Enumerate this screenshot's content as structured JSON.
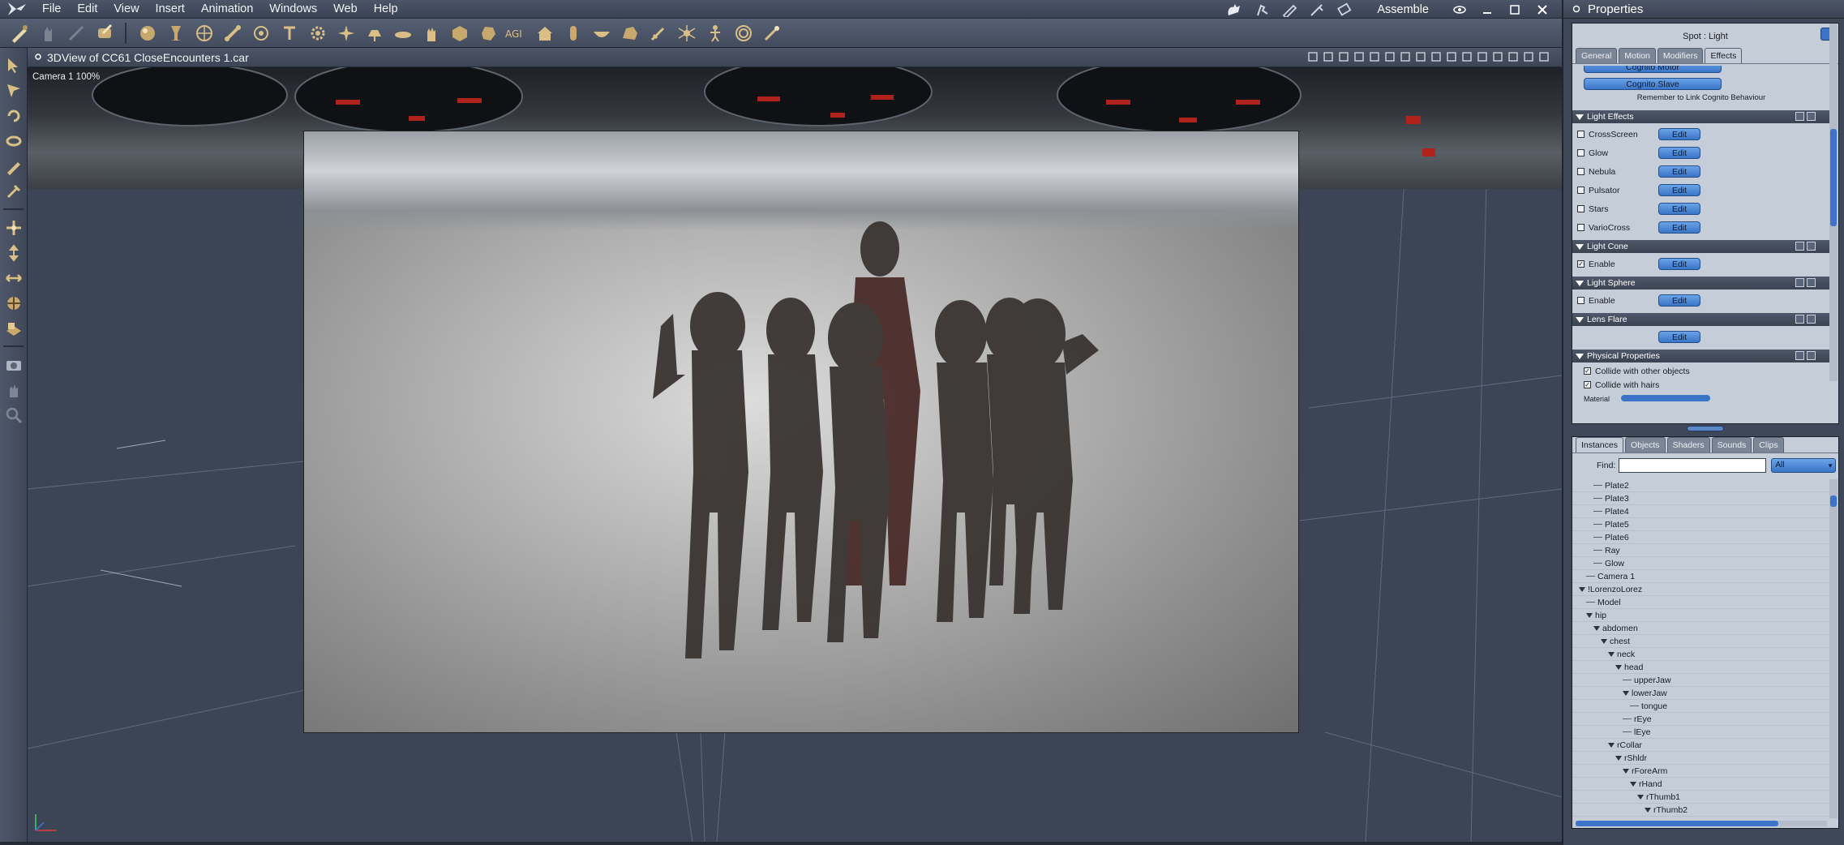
{
  "app": {
    "logo_icon": "poser-figure-logo-icon",
    "workspace": "Assemble"
  },
  "menu": {
    "items": [
      "File",
      "Edit",
      "View",
      "Insert",
      "Animation",
      "Windows",
      "Web",
      "Help"
    ]
  },
  "toolbar": {
    "icons": [
      "select-pen-icon",
      "figure-hand-icon",
      "disabled-tool-icon",
      "brush-tool-icon",
      "sphere-primitive-icon",
      "goblet-icon",
      "globe-icon",
      "bone-icon",
      "target-icon",
      "text-tool-icon",
      "gear-icon",
      "star-burst-icon",
      "lamp-icon",
      "plate-icon",
      "hand-icon",
      "cube-icon",
      "asteroid-icon",
      "text-agi-icon",
      "house-icon",
      "cylinder-icon",
      "dish-icon",
      "rock-icon",
      "sword-icon",
      "spider-icon",
      "puppet-icon",
      "target-ring-icon",
      "wand-icon"
    ]
  },
  "left_tools": {
    "icons": [
      "pointer-arrow-icon",
      "select-arrow-icon",
      "rotate-icon",
      "twist-icon",
      "pencil-icon",
      "pipette-icon",
      "move-xyz-icon",
      "translate-icon",
      "scale-icon",
      "orbit-icon",
      "floor-grid-icon",
      "camera-icon",
      "hand-pan-icon",
      "zoom-magnifier-icon"
    ]
  },
  "view": {
    "title": "3DView of CC61 CloseEncounters 1.car",
    "camera_label": "Camera 1 100%",
    "tools": [
      "lights-icon",
      "camera-select-icon",
      "x-box-icon",
      "single-view-icon",
      "two-view-icon",
      "three-view-icon",
      "four-view-icon",
      "shield-a-icon",
      "shield-b-icon",
      "shield-c-icon",
      "move-view-icon",
      "fit-icon",
      "box-view-icon",
      "cube-view-icon",
      "sphere-view-icon",
      "sphere-dark-icon"
    ]
  },
  "properties": {
    "panel_title": "Properties",
    "object_title": "Spot : Light",
    "tabs": [
      "General",
      "Motion",
      "Modifiers",
      "Effects"
    ],
    "active_tab": "Effects",
    "cognito": {
      "motor": "Cognito Motor",
      "slave": "Cognito Slave",
      "note": "Remember to Link Cognito Behaviour"
    },
    "light_effects": {
      "title": "Light Effects",
      "rows": [
        {
          "label": "CrossScreen",
          "checked": false,
          "button": "Edit"
        },
        {
          "label": "Glow",
          "checked": false,
          "button": "Edit"
        },
        {
          "label": "Nebula",
          "checked": false,
          "button": "Edit"
        },
        {
          "label": "Pulsator",
          "checked": false,
          "button": "Edit"
        },
        {
          "label": "Stars",
          "checked": false,
          "button": "Edit"
        },
        {
          "label": "VarioCross",
          "checked": false,
          "button": "Edit"
        }
      ]
    },
    "light_cone": {
      "title": "Light Cone",
      "label": "Enable",
      "checked": true,
      "button": "Edit"
    },
    "light_sphere": {
      "title": "Light Sphere",
      "label": "Enable",
      "checked": false,
      "button": "Edit"
    },
    "lens_flare": {
      "title": "Lens Flare",
      "button": "Edit"
    },
    "physical": {
      "title": "Physical Properties",
      "rows": [
        {
          "label": "Collide with other objects",
          "checked": true
        },
        {
          "label": "Collide with hairs",
          "checked": true
        }
      ],
      "partial": "Material"
    }
  },
  "instances": {
    "tabs": [
      "Instances",
      "Objects",
      "Shaders",
      "Sounds",
      "Clips"
    ],
    "active_tab": "Instances",
    "find_label": "Find:",
    "find_value": "",
    "filter": "All",
    "tree": [
      {
        "label": "Plate2",
        "depth": 2,
        "expanded": false
      },
      {
        "label": "Plate3",
        "depth": 2,
        "expanded": false
      },
      {
        "label": "Plate4",
        "depth": 2,
        "expanded": false
      },
      {
        "label": "Plate5",
        "depth": 2,
        "expanded": false
      },
      {
        "label": "Plate6",
        "depth": 2,
        "expanded": false
      },
      {
        "label": "Ray",
        "depth": 2,
        "expanded": false
      },
      {
        "label": "Glow",
        "depth": 2,
        "expanded": false
      },
      {
        "label": "Camera 1",
        "depth": 1,
        "expanded": false
      },
      {
        "label": "!LorenzoLorez",
        "depth": 0,
        "expanded": true
      },
      {
        "label": "Model",
        "depth": 1,
        "expanded": false
      },
      {
        "label": "hip",
        "depth": 1,
        "expanded": true
      },
      {
        "label": "abdomen",
        "depth": 2,
        "expanded": true
      },
      {
        "label": "chest",
        "depth": 3,
        "expanded": true
      },
      {
        "label": "neck",
        "depth": 4,
        "expanded": true
      },
      {
        "label": "head",
        "depth": 5,
        "expanded": true
      },
      {
        "label": "upperJaw",
        "depth": 6,
        "expanded": false
      },
      {
        "label": "lowerJaw",
        "depth": 6,
        "expanded": true
      },
      {
        "label": "tongue",
        "depth": 7,
        "expanded": false
      },
      {
        "label": "rEye",
        "depth": 6,
        "expanded": false
      },
      {
        "label": "lEye",
        "depth": 6,
        "expanded": false
      },
      {
        "label": "rCollar",
        "depth": 4,
        "expanded": true
      },
      {
        "label": "rShldr",
        "depth": 5,
        "expanded": true
      },
      {
        "label": "rForeArm",
        "depth": 6,
        "expanded": true
      },
      {
        "label": "rHand",
        "depth": 7,
        "expanded": true
      },
      {
        "label": "rThumb1",
        "depth": 8,
        "expanded": true
      },
      {
        "label": "rThumb2",
        "depth": 9,
        "expanded": true
      }
    ]
  },
  "colors": {
    "accent": "#3d74c9",
    "panel": "#c4cdd8",
    "chrome": "#3f4858"
  }
}
